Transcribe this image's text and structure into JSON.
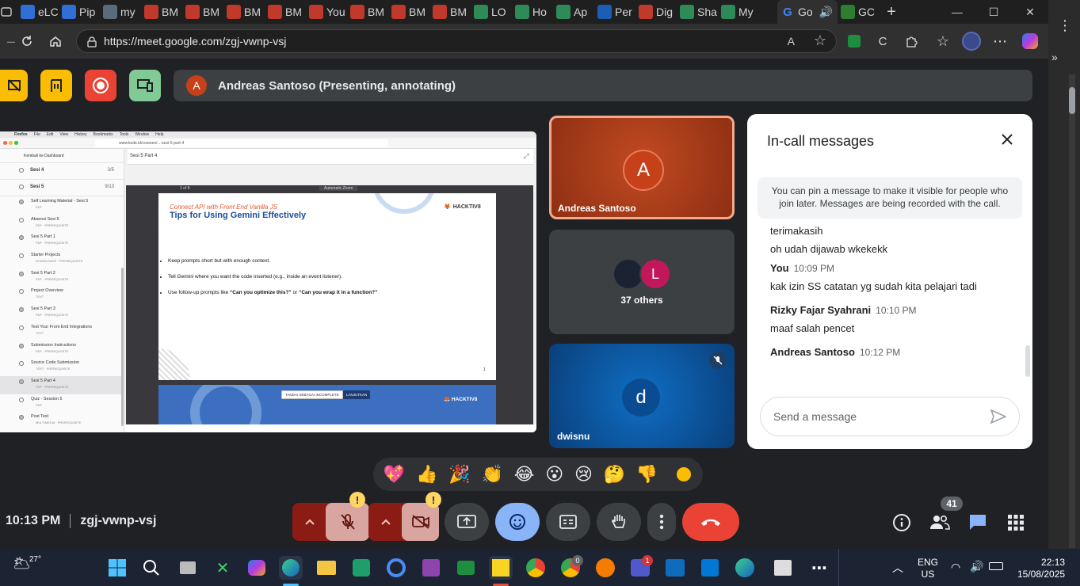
{
  "browser": {
    "tabs": [
      {
        "label": "eLC",
        "color": "#2f6fd6"
      },
      {
        "label": "Pip",
        "color": "#2f6fd6"
      },
      {
        "label": "my",
        "color": "#5a6b7a"
      },
      {
        "label": "BM",
        "color": "#c0392b"
      },
      {
        "label": "BM",
        "color": "#c0392b"
      },
      {
        "label": "BM",
        "color": "#c0392b"
      },
      {
        "label": "BM",
        "color": "#c0392b"
      },
      {
        "label": "You",
        "color": "#c0392b"
      },
      {
        "label": "BM",
        "color": "#c0392b"
      },
      {
        "label": "BM",
        "color": "#c0392b"
      },
      {
        "label": "BM",
        "color": "#c0392b"
      },
      {
        "label": "LO",
        "color": "#2e8b57"
      },
      {
        "label": "Ho",
        "color": "#2e8b57"
      },
      {
        "label": "Ap",
        "color": "#2e8b57"
      },
      {
        "label": "Per",
        "color": "#1a5fb4"
      },
      {
        "label": "Dig",
        "color": "#c0392b"
      },
      {
        "label": "Sha",
        "color": "#2e8b57"
      },
      {
        "label": "My",
        "color": "#2e8b57"
      }
    ],
    "active_tab": {
      "label": "Go"
    },
    "last_tab": {
      "label": "GC"
    },
    "new_tab": "+",
    "window_min": "—",
    "window_max": "☐",
    "window_close": "✕",
    "url": "https://meet.google.com/zgj-vwnp-vsj",
    "read_aloud": "A",
    "more": "⋯"
  },
  "meet": {
    "presenter_initial": "A",
    "presenting_banner": "Andreas Santoso (Presenting, annotating)",
    "tiles": {
      "andreas": {
        "initial": "A",
        "name": "Andreas Santoso"
      },
      "others": {
        "initial": "L",
        "label": "37 others"
      },
      "dwisnu": {
        "initial": "d",
        "name": "dwisnu"
      }
    },
    "chat": {
      "title": "In-call messages",
      "info": "You can pin a message to make it visible for people who join later. Messages are being recorded with the call.",
      "messages": [
        {
          "sender": "",
          "time": "",
          "text": "terimakasih"
        },
        {
          "sender": "",
          "time": "",
          "text": "oh udah dijawab wkekekk"
        },
        {
          "sender": "You",
          "time": "10:09 PM",
          "text": "kak izin SS catatan yg sudah kita pelajari tadi"
        },
        {
          "sender": "Rizky Fajar Syahrani",
          "time": "10:10 PM",
          "text": "maaf salah pencet"
        },
        {
          "sender": "Andreas Santoso",
          "time": "10:12 PM",
          "text": ""
        }
      ],
      "input_placeholder": "Send a message"
    },
    "reactions": [
      "💖",
      "👍",
      "🎉",
      "👏",
      "😂",
      "😮",
      "😢",
      "🤔",
      "👎"
    ],
    "clock": "10:13 PM",
    "meeting_code": "zgj-vwnp-vsj",
    "people_count": "41",
    "mic_warning": "!",
    "cam_warning": "!"
  },
  "shared": {
    "menubar": [
      "Firefox",
      "File",
      "Edit",
      "View",
      "History",
      "Bookmarks",
      "Tools",
      "Window",
      "Help"
    ],
    "url": "www.kode.id/courses/...-sesi-5-part-4",
    "back_link": "Kembali ke Dashboard",
    "sidebar": [
      {
        "title": "Sesi 4",
        "meta": "3/5",
        "section": true
      },
      {
        "title": "Sesi 5",
        "meta": "9/13",
        "section": true
      },
      {
        "title": "Self Learning Material - Sesi 5",
        "meta": "PDF"
      },
      {
        "title": "Absensi Sesi 5",
        "meta": "PDF · PREREQUISITE"
      },
      {
        "title": "Sesi 5 Part 1",
        "meta": "PDF · PREREQUISITE"
      },
      {
        "title": "Starter Projects",
        "meta": "DOWNLOADS · PREREQUISITE"
      },
      {
        "title": "Sesi 5 Part 2",
        "meta": "PDF · PREREQUISITE"
      },
      {
        "title": "Project Overview",
        "meta": "TEXT"
      },
      {
        "title": "Sesi 5 Part 3",
        "meta": "PDF · PREREQUISITE"
      },
      {
        "title": "Test Your Front End Integrations",
        "meta": "TEXT"
      },
      {
        "title": "Submission Instructions",
        "meta": "PDF · PREREQUISITE"
      },
      {
        "title": "Source Code Submission",
        "meta": "TEXT · PREREQUISITE"
      },
      {
        "title": "Sesi 5 Part 4",
        "meta": "PDF · PREREQUISITE"
      },
      {
        "title": "Quiz - Session 5",
        "meta": "PDF"
      },
      {
        "title": "Post Test",
        "meta": "MULTIMEDIA · PREREQUISITE"
      }
    ],
    "doc_title": "Sesi 5 Part 4",
    "pdf_page": "1 of 8",
    "pdf_zoom": "Automatic Zoom",
    "slide_subtitle": "Connect API with Front End Vanilla JS",
    "slide_title": "Tips for Using Gemini Effectively",
    "brand": "HACKTIV8",
    "bullets": [
      {
        "plain": "Keep prompts short but with enough context.",
        "b1": "",
        "mid": "",
        "b2": ""
      },
      {
        "plain": "Tell Gemini where you want the code inserted (e.g., inside an event listener).",
        "b1": "",
        "mid": "",
        "b2": ""
      },
      {
        "plain": "Use follow-up prompts like ",
        "b1": "“Can you optimize this?”",
        "mid": " or ",
        "b2": "“Can you wrap it in a function?”"
      }
    ],
    "page_no": "1",
    "btn_incomplete": "TANDAI SEBAGAI INCOMPLETE",
    "btn_next": "LANJUTKAN"
  },
  "taskbar": {
    "weather": "27°",
    "lang1": "ENG",
    "lang2": "US",
    "time": "22:13",
    "date": "15/08/2025",
    "badge_teams": "1",
    "badge_chrome": "0"
  },
  "colors": {
    "meet_bg": "#202124",
    "accent_blue": "#8ab4f8",
    "end_call": "#ea4335",
    "tile_andreas": "#a33a1a",
    "tile_dwisnu": "#0d5aa7"
  }
}
